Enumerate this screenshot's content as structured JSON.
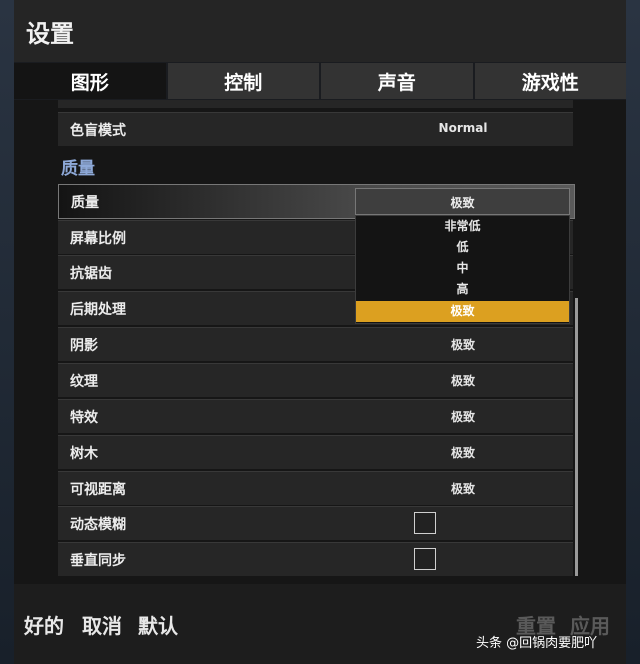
{
  "window": {
    "title": "设置"
  },
  "tabs": [
    {
      "label": "图形",
      "active": true
    },
    {
      "label": "控制",
      "active": false
    },
    {
      "label": "声音",
      "active": false
    },
    {
      "label": "游戏性",
      "active": false
    }
  ],
  "settings": {
    "color_blind": {
      "label": "色盲模式",
      "value": "Normal"
    },
    "section_title": "质量",
    "quality": {
      "label": "质量",
      "value": "极致"
    },
    "rows": [
      {
        "label": "屏幕比例",
        "value": ""
      },
      {
        "label": "抗锯齿",
        "value": ""
      },
      {
        "label": "后期处理",
        "value": ""
      },
      {
        "label": "阴影",
        "value": "极致"
      },
      {
        "label": "纹理",
        "value": "极致"
      },
      {
        "label": "特效",
        "value": "极致"
      },
      {
        "label": "树木",
        "value": "极致"
      },
      {
        "label": "可视距离",
        "value": "极致"
      }
    ],
    "checkboxes": [
      {
        "label": "动态模糊",
        "checked": false
      },
      {
        "label": "垂直同步",
        "checked": false
      }
    ]
  },
  "dropdown": {
    "selected": "极致",
    "options": [
      "非常低",
      "低",
      "中",
      "高",
      "极致"
    ]
  },
  "footer": {
    "ok": "好的",
    "cancel": "取消",
    "default": "默认",
    "reset": "重置",
    "apply": "应用"
  },
  "watermark": "头条 @回锅肉要肥吖",
  "colors": {
    "accent": "#dca020",
    "section": "#8ea9d8"
  }
}
